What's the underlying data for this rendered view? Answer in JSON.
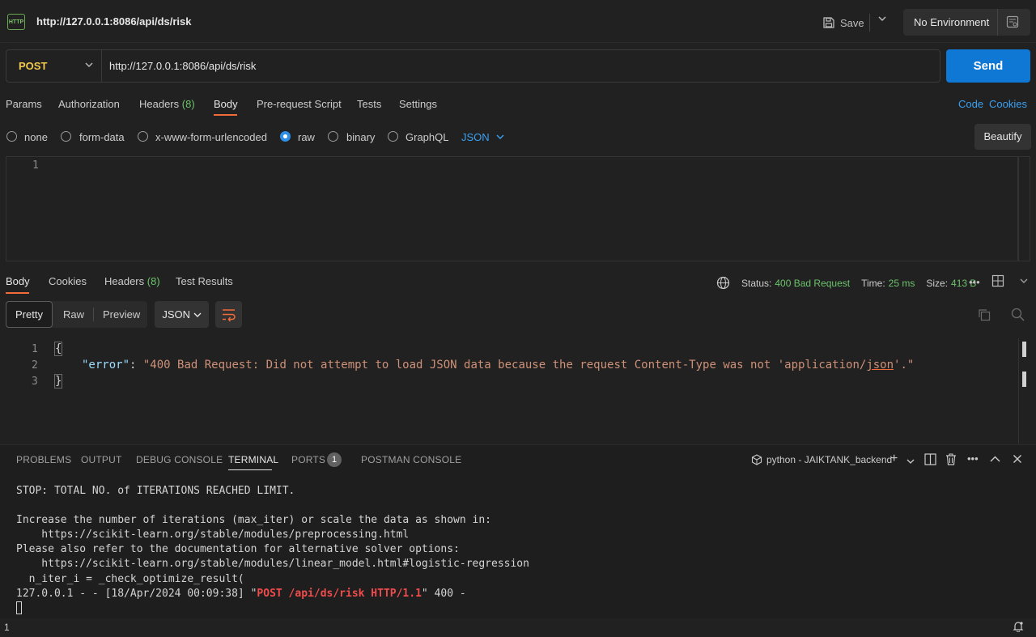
{
  "window": {
    "title_url": "http://127.0.0.1:8086/api/ds/risk",
    "http_icon": "HTTP",
    "save_label": "Save",
    "environment": "No Environment"
  },
  "request": {
    "method": "POST",
    "url": "http://127.0.0.1:8086/api/ds/risk",
    "send_label": "Send",
    "tabs": [
      {
        "label": "Params"
      },
      {
        "label": "Authorization"
      },
      {
        "label": "Headers",
        "count": "(8)"
      },
      {
        "label": "Body"
      },
      {
        "label": "Pre-request Script"
      },
      {
        "label": "Tests"
      },
      {
        "label": "Settings"
      }
    ],
    "active_tab": "Body",
    "right_links": [
      "Code",
      "Cookies"
    ],
    "body_types": [
      "none",
      "form-data",
      "x-www-form-urlencoded",
      "raw",
      "binary",
      "GraphQL"
    ],
    "selected_body_type": "raw",
    "raw_format": "JSON",
    "beautify_label": "Beautify",
    "editor_line": "1"
  },
  "response": {
    "tabs": [
      {
        "label": "Body"
      },
      {
        "label": "Cookies"
      },
      {
        "label": "Headers",
        "count": "(8)"
      },
      {
        "label": "Test Results"
      }
    ],
    "status_label": "Status:",
    "status_value": "400 Bad Request",
    "time_label": "Time:",
    "time_value": "25 ms",
    "size_label": "Size:",
    "size_value": "413 B",
    "views": [
      "Pretty",
      "Raw",
      "Preview"
    ],
    "format": "JSON",
    "line_numbers": [
      "1",
      "2",
      "3"
    ],
    "open_brace": "{",
    "close_brace": "}",
    "error_key": "\"error\"",
    "colon": ": ",
    "error_value_start": "\"400 Bad Request: Did not attempt to load JSON data because the request Content-Type was not 'application/",
    "error_value_underlined": "json",
    "error_value_end": "'.\""
  },
  "panel": {
    "tabs": [
      "PROBLEMS",
      "OUTPUT",
      "DEBUG CONSOLE",
      "TERMINAL",
      "PORTS",
      "POSTMAN CONSOLE"
    ],
    "ports_count": "1",
    "terminal_name": "python - JAIKTANK_backend",
    "lines": [
      "STOP: TOTAL NO. of ITERATIONS REACHED LIMIT.",
      "",
      "Increase the number of iterations (max_iter) or scale the data as shown in:",
      "    https://scikit-learn.org/stable/modules/preprocessing.html",
      "Please also refer to the documentation for alternative solver options:",
      "    https://scikit-learn.org/stable/modules/linear_model.html#logistic-regression",
      "  n_iter_i = _check_optimize_result("
    ],
    "log_prefix": "127.0.0.1 - - [18/Apr/2024 00:09:38] \"",
    "log_request": "POST /api/ds/risk HTTP/1.1",
    "log_suffix": "\" 400 -"
  },
  "statusbar": {
    "left_text": "1"
  }
}
